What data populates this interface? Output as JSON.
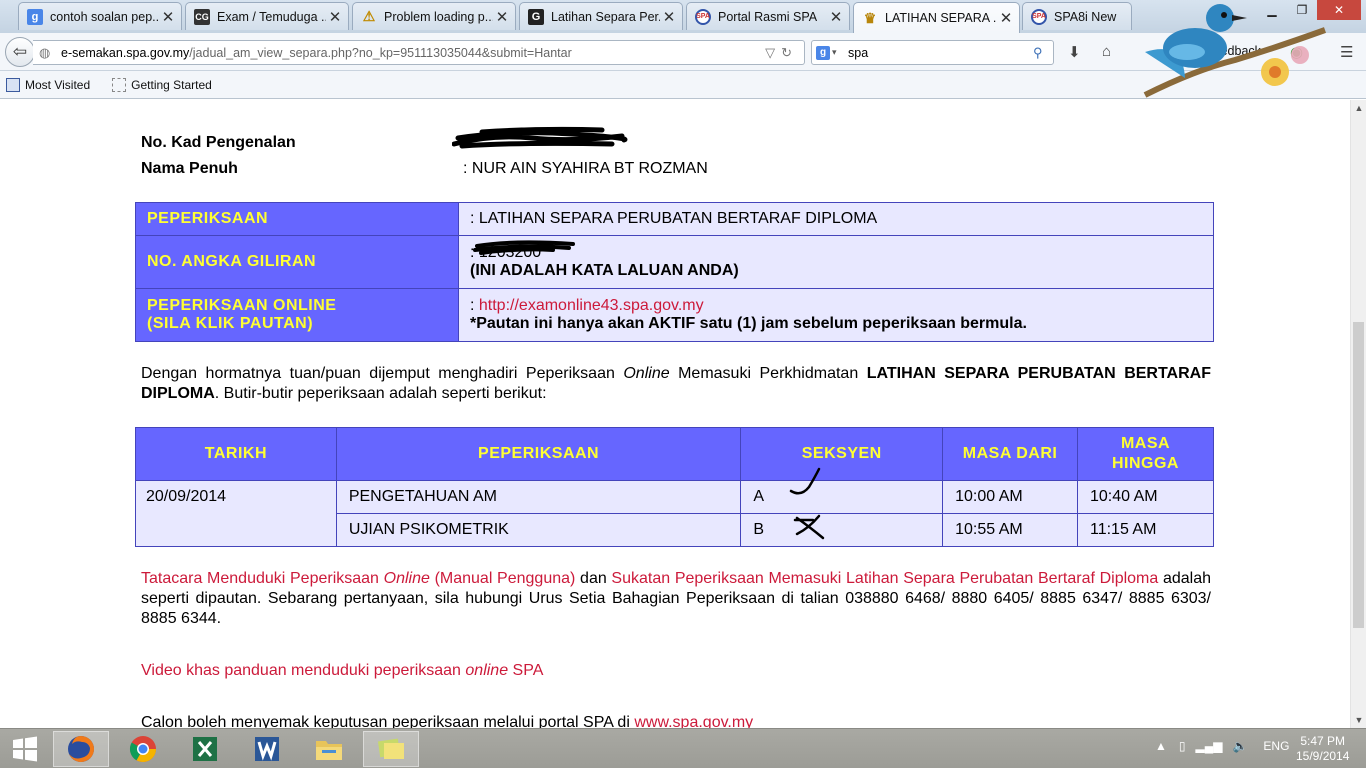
{
  "browser": {
    "tabs": [
      {
        "label": "contoh soalan pep...",
        "icon": "google-icon"
      },
      {
        "label": "Exam / Temuduga ...",
        "icon": "cg-icon"
      },
      {
        "label": "Problem loading p...",
        "icon": "warning-icon"
      },
      {
        "label": "Latihan Separa Per...",
        "icon": "g-icon"
      },
      {
        "label": "Portal Rasmi SPA",
        "icon": "spa-logo-icon"
      },
      {
        "label": "LATIHAN SEPARA ...",
        "icon": "crest-icon"
      },
      {
        "label": "SPA8i New",
        "icon": "spa-logo-icon"
      }
    ],
    "url_domain": "e-semakan.spa.gov.my",
    "url_path": "/jadual_am_view_separa.php?no_kp=951113035044&submit=Hantar",
    "search_value": "spa",
    "feedback_label": "Feedback",
    "bookmarks": [
      {
        "label": "Most Visited",
        "icon": "most-visited-icon"
      },
      {
        "label": "Getting Started",
        "icon": "page-icon"
      }
    ]
  },
  "page": {
    "ic_label": "No. Kad Pengenalan",
    "name_label": "Nama Penuh",
    "name_value": ":  NUR AIN SYAHIRA BT ROZMAN",
    "info_rows": {
      "exam_label": "PEPERIKSAAN",
      "exam_value": ": LATIHAN SEPARA PERUBATAN BERTARAF DIPLOMA",
      "turn_label": "NO. ANGKA GILIRAN",
      "turn_value_prefix": ": 1203200",
      "turn_note": "(INI ADALAH KATA LALUAN ANDA)",
      "online_label_1": "PEPERIKSAAN ONLINE",
      "online_label_2": "(SILA KLIK PAUTAN)",
      "online_prefix": ": ",
      "online_link": "http://examonline43.spa.gov.my",
      "online_note": "*Pautan ini hanya akan AKTIF satu (1) jam sebelum peperiksaan bermula."
    },
    "intro": {
      "part1": "Dengan hormatnya tuan/puan dijemput menghadiri Peperiksaan ",
      "italic": "Online",
      "part2": " Memasuki Perkhidmatan ",
      "bold": "LATIHAN SEPARA PERUBATAN BERTARAF DIPLOMA",
      "part3": ". Butir-butir peperiksaan adalah seperti berikut:"
    },
    "schedule": {
      "headers": [
        "TARIKH",
        "PEPERIKSAAN",
        "SEKSYEN",
        "MASA DARI",
        "MASA HINGGA"
      ],
      "date": "20/09/2014",
      "rows": [
        {
          "exam": "PENGETAHUAN AM",
          "section": "A",
          "from": "10:00 AM",
          "to": "10:40 AM"
        },
        {
          "exam": "UJIAN PSIKOMETRIK",
          "section": "B",
          "from": "10:55 AM",
          "to": "11:15 AM"
        }
      ]
    },
    "links_para": {
      "link1a": "Tatacara Menduduki Peperiksaan ",
      "link1_italic": "Online",
      "link1b": " (Manual Pengguna)",
      "and": " dan ",
      "link2": "Sukatan Peperiksaan Memasuki Latihan Separa Perubatan Bertaraf Diploma",
      "rest": " adalah seperti dipautan. Sebarang pertanyaan, sila hubungi Urus Setia Bahagian Peperiksaan di talian 038880 6468/ 8880 6405/ 8885 6347/ 8885 6303/ 8885 6344."
    },
    "video": {
      "a": "Video khas panduan menduduki peperiksaan ",
      "italic": "online",
      "b": " SPA"
    },
    "footer": {
      "text": "Calon boleh menyemak keputusan peperiksaan melalui portal SPA di ",
      "link": "www.spa.gov.my"
    }
  },
  "taskbar": {
    "apps": [
      "windows-start-icon",
      "firefox-icon",
      "chrome-icon",
      "excel-icon",
      "word-icon",
      "file-explorer-icon",
      "photo-viewer-icon"
    ],
    "language": "ENG",
    "time": "5:47 PM",
    "date": "15/9/2014"
  },
  "colors": {
    "header_bg": "#6666ff",
    "header_text": "#ffff33",
    "cell_bg": "#e8e8ff",
    "link": "#cc1a3a"
  }
}
